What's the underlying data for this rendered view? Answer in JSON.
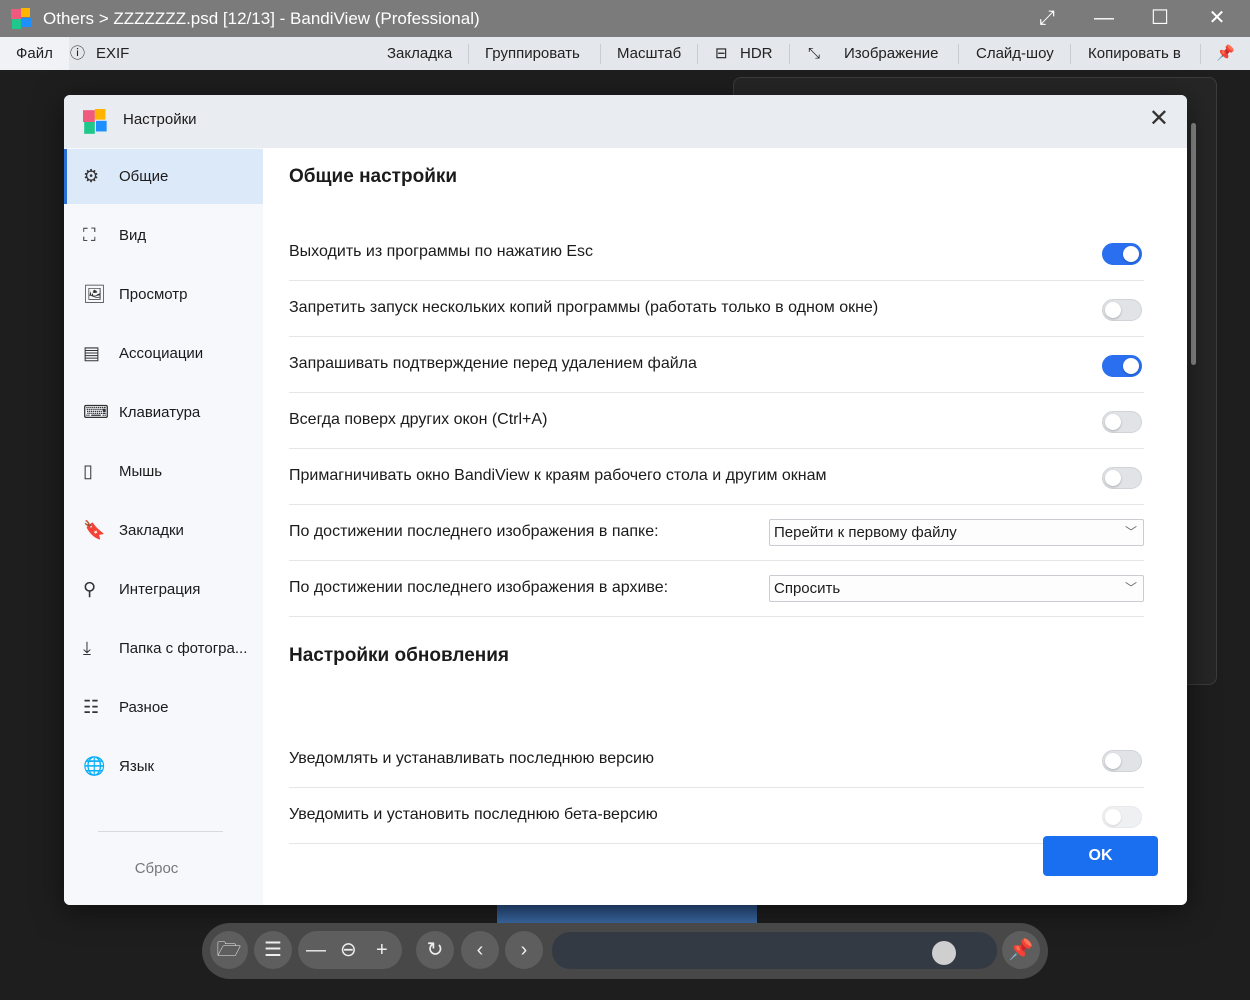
{
  "window": {
    "title": "Others > ZZZZZZZ.psd [12/13] - BandiView (Professional)"
  },
  "menu": {
    "file": "Файл",
    "exif": "EXIF",
    "bookmark": "Закладка",
    "group": "Группировать",
    "zoom": "Масштаб",
    "hdr": "HDR",
    "image": "Изображение",
    "slideshow": "Слайд-шоу",
    "copy_to": "Копировать в"
  },
  "dialog": {
    "title": "Настройки",
    "sidebar": [
      {
        "label": "Общие",
        "icon": "gear-icon",
        "selected": true
      },
      {
        "label": "Вид",
        "icon": "frame-icon"
      },
      {
        "label": "Просмотр",
        "icon": "image-icon"
      },
      {
        "label": "Ассоциации",
        "icon": "document-icon"
      },
      {
        "label": "Клавиатура",
        "icon": "keyboard-icon"
      },
      {
        "label": "Мышь",
        "icon": "mouse-icon"
      },
      {
        "label": "Закладки",
        "icon": "bookmark-icon"
      },
      {
        "label": "Интеграция",
        "icon": "search-icon"
      },
      {
        "label": "Папка с фотогра...",
        "icon": "download-icon"
      },
      {
        "label": "Разное",
        "icon": "sliders-icon"
      },
      {
        "label": "Язык",
        "icon": "globe-icon"
      }
    ],
    "reset": "Сброс",
    "general_heading": "Общие настройки",
    "general": [
      {
        "label": "Выходить из программы по нажатию Esc",
        "type": "toggle",
        "on": true
      },
      {
        "label": "Запретить запуск нескольких копий программы (работать только в одном окне)",
        "type": "toggle",
        "on": false
      },
      {
        "label": "Запрашивать подтверждение перед удалением файла",
        "type": "toggle",
        "on": true
      },
      {
        "label": "Всегда поверх других окон (Ctrl+A)",
        "type": "toggle",
        "on": false
      },
      {
        "label": "Примагничивать окно BandiView к краям рабочего стола и другим окнам",
        "type": "toggle",
        "on": false
      },
      {
        "label": "По достижении последнего изображения в папке:",
        "type": "select",
        "value": "Перейти к первому файлу"
      },
      {
        "label": "По достижении последнего изображения в архиве:",
        "type": "select",
        "value": "Спросить"
      }
    ],
    "update_heading": "Настройки обновления",
    "update": [
      {
        "label": "Уведомлять и устанавливать последнюю версию",
        "type": "toggle",
        "on": false
      },
      {
        "label": "Уведомить и установить последнюю бета-версию",
        "type": "toggle",
        "on": false,
        "disabled": true
      }
    ],
    "ok": "OK"
  },
  "bottombar": {
    "slider_value": 0.88
  },
  "colors": {
    "accent": "#1a6ff0",
    "titlebar": "#7b7b7b"
  }
}
